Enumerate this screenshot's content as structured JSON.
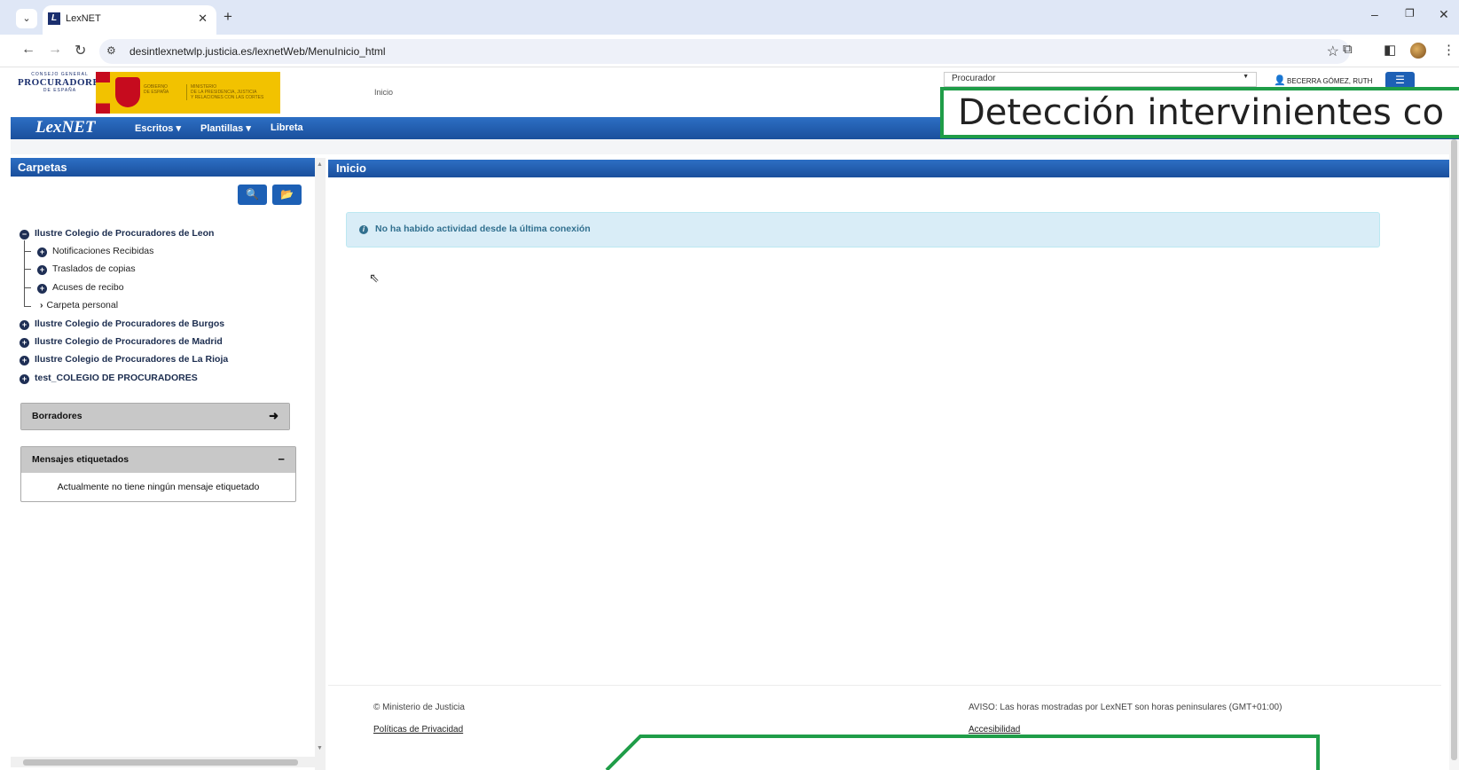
{
  "browser": {
    "tab_title": "LexNET",
    "url": "desintlexnetwlp.justicia.es/lexnetWeb/MenuInicio_html"
  },
  "header": {
    "cgp_logo_top": "CONSEJO GENERAL",
    "cgp_logo_main": "PROCURADORES",
    "cgp_logo_bottom": "DE ESPAÑA",
    "gob_line1": "GOBIERNO",
    "gob_line2": "DE ESPAÑA",
    "ministerio_line1": "MINISTERIO",
    "ministerio_line2": "DE LA PRESIDENCIA, JUSTICIA",
    "ministerio_line3": "Y RELACIONES CON LAS CORTES",
    "breadcrumb": "Inicio",
    "role": "Procurador",
    "user_name": "BECERRA GÓMEZ, RUTH"
  },
  "overlay": {
    "caption": "Detección intervinientes co"
  },
  "navbar": {
    "brand": "LexNET",
    "items": [
      {
        "label": "Escritos ▾"
      },
      {
        "label": "Plantillas ▾"
      },
      {
        "label": "Libreta"
      }
    ]
  },
  "left_panel": {
    "title": "Carpetas",
    "tree": [
      {
        "label": "Ilustre Colegio de Procuradores de Leon",
        "state": "expanded"
      },
      {
        "label": "Notificaciones Recibidas",
        "state": "collapsed"
      },
      {
        "label": "Traslados de copias",
        "state": "collapsed"
      },
      {
        "label": "Acuses de recibo",
        "state": "collapsed"
      },
      {
        "label": "Carpeta personal",
        "state": "leaf"
      },
      {
        "label": "Ilustre Colegio de Procuradores de Burgos",
        "state": "collapsed"
      },
      {
        "label": "Ilustre Colegio de Procuradores de Madrid",
        "state": "collapsed"
      },
      {
        "label": "Ilustre Colegio de Procuradores de La Rioja",
        "state": "collapsed"
      },
      {
        "label": "test_COLEGIO DE PROCURADORES",
        "state": "collapsed"
      }
    ],
    "borradores": {
      "title": "Borradores"
    },
    "etiquetados": {
      "title": "Mensajes etiquetados",
      "empty_text": "Actualmente no tiene ningún mensaje etiquetado"
    }
  },
  "main": {
    "title": "Inicio",
    "alert": "No ha habido actividad desde la última conexión"
  },
  "footer": {
    "copyright": "© Ministerio de Justicia",
    "privacy_link": "Políticas de Privacidad",
    "notice": "AVISO: Las horas mostradas por LexNET son horas peninsulares (GMT+01:00)",
    "accessibility_link": "Accesibilidad"
  },
  "colors": {
    "accent_blue": "#1d60b5",
    "alert_bg": "#d9edf7",
    "overlay_border": "#1f9d48"
  }
}
